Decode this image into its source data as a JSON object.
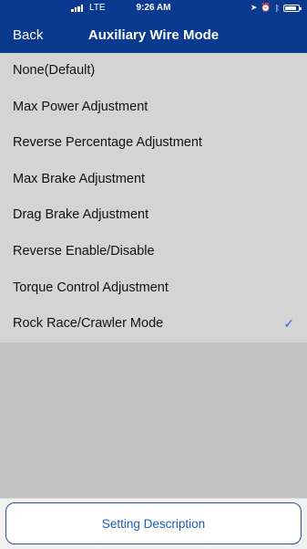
{
  "status_bar": {
    "carrier": "LTE",
    "time": "9:26 AM",
    "icons": [
      "signal-icon",
      "location-icon",
      "alarm-icon",
      "bluetooth-icon",
      "battery-icon"
    ]
  },
  "nav": {
    "back_label": "Back",
    "title": "Auxiliary Wire Mode"
  },
  "options": [
    {
      "label": "None(Default)",
      "selected": false
    },
    {
      "label": "Max Power Adjustment",
      "selected": false
    },
    {
      "label": "Reverse Percentage Adjustment",
      "selected": false
    },
    {
      "label": "Max Brake Adjustment",
      "selected": false
    },
    {
      "label": "Drag Brake Adjustment",
      "selected": false
    },
    {
      "label": "Reverse Enable/Disable",
      "selected": false
    },
    {
      "label": "Torque Control Adjustment",
      "selected": false
    },
    {
      "label": "Rock Race/Crawler Mode",
      "selected": true
    }
  ],
  "check_glyph": "✓",
  "footer": {
    "button_label": "Setting Description"
  },
  "colors": {
    "nav_bg": "#0a3a8f",
    "accent": "#1f6fe0",
    "list_bg": "#d4d4d4"
  }
}
